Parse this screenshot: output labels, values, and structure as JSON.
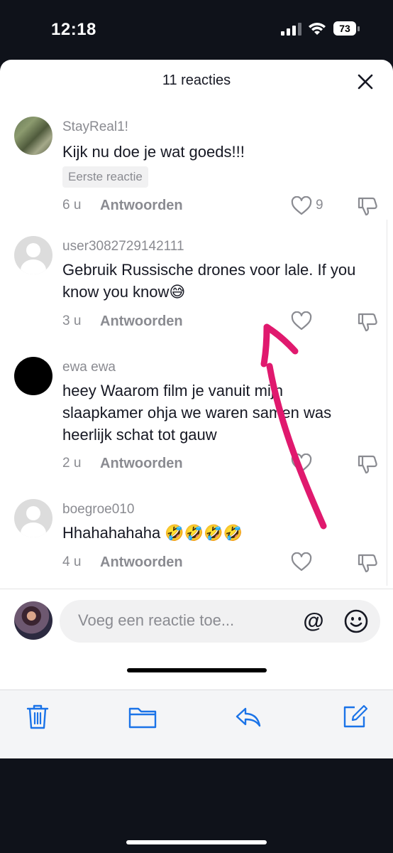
{
  "status_bar": {
    "time": "12:18",
    "battery": "73"
  },
  "sheet": {
    "title": "11 reacties",
    "comments": [
      {
        "username": "StayReal1!",
        "text": "Kijk nu doe je wat goeds!!!",
        "badge": "Eerste reactie",
        "time": "6 u",
        "reply": "Antwoorden",
        "likes": "9"
      },
      {
        "username": "user3082729142111",
        "text": "Gebruik Russische drones voor lale. If you know you know😅",
        "time": "3 u",
        "reply": "Antwoorden"
      },
      {
        "username": "ewa ewa",
        "text": "heey Waarom film je vanuit mijn slaapkamer ohja we waren samen was heerlijk schat tot gauw",
        "time": "2 u",
        "reply": "Antwoorden"
      },
      {
        "username": "boegroe010",
        "text": "Hhahahahaha 🤣🤣🤣🤣",
        "time": "4 u",
        "reply": "Antwoorden"
      }
    ],
    "input": {
      "placeholder": "Voeg een reactie toe...",
      "at_label": "@"
    }
  },
  "toolbar": {
    "icons": [
      "trash-icon",
      "folder-icon",
      "reply-icon",
      "compose-icon"
    ]
  },
  "colors": {
    "annotation": "#e0196e",
    "text_secondary": "#8a8b91"
  }
}
